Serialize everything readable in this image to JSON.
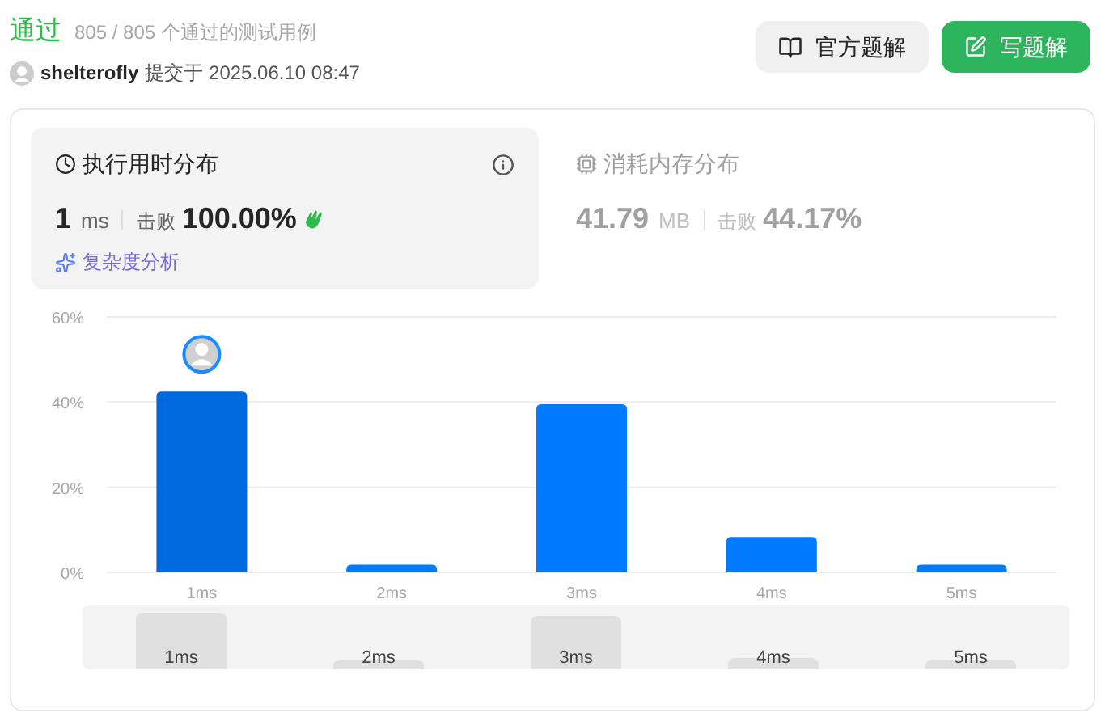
{
  "status": {
    "title": "通过",
    "cases": "805 / 805 个通过的测试用例"
  },
  "submission": {
    "user": "shelterofly",
    "submitted": "提交于 2025.06.10 08:47"
  },
  "buttons": [
    {
      "label": "官方题解",
      "kind": "secondary"
    },
    {
      "label": "写题解",
      "kind": "primary"
    }
  ],
  "panels": [
    {
      "title": "执行用时分布",
      "selected": true,
      "value": "1",
      "unit": "ms",
      "beats_label": "击败",
      "beats": "100.00%",
      "analysis": "复杂度分析"
    },
    {
      "title": "消耗内存分布",
      "selected": false,
      "value": "41.79",
      "unit": "MB",
      "beats_label": "击败",
      "beats": "44.17%"
    }
  ],
  "chart": {
    "chart_data": {
      "type": "bar",
      "categories": [
        "1ms",
        "2ms",
        "3ms",
        "4ms",
        "5ms"
      ],
      "values": [
        42.5,
        1.8,
        39.5,
        8.3,
        1.8
      ],
      "ylim": [
        0,
        60
      ],
      "yticks": [
        {
          "value": 0,
          "label": "0%"
        },
        {
          "value": 20,
          "label": "20%"
        },
        {
          "value": 40,
          "label": "40%"
        },
        {
          "value": 60,
          "label": "60%"
        }
      ]
    },
    "bars": [
      {
        "selected": true
      },
      {
        "selected": false
      },
      {
        "selected": false
      },
      {
        "selected": false
      },
      {
        "selected": false
      }
    ]
  },
  "overview": {
    "labels": [
      "1ms",
      "2ms",
      "3ms",
      "4ms",
      "5ms"
    ]
  }
}
